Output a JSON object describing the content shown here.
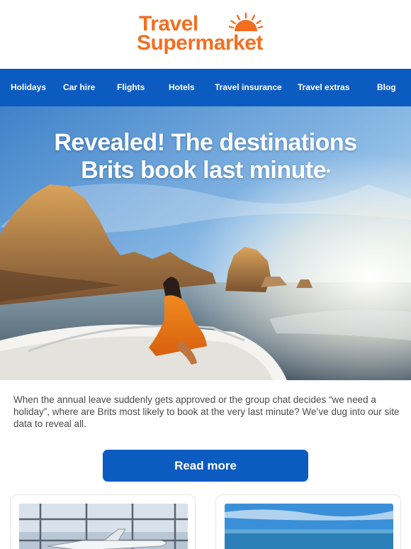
{
  "brand": {
    "line1": "Travel",
    "line2": "Supermarket",
    "color": "#f26f21",
    "logo_icon": "sun-icon"
  },
  "nav": {
    "background": "#0c5bc0",
    "items": [
      {
        "label": "Holidays"
      },
      {
        "label": "Car hire"
      },
      {
        "label": "Flights"
      },
      {
        "label": "Hotels"
      },
      {
        "label": "Travel insurance"
      },
      {
        "label": "Travel extras"
      },
      {
        "label": "Blog"
      }
    ]
  },
  "hero": {
    "title_line1": "Revealed! The destinations",
    "title_line2": "Brits book last minute",
    "title_mark": "*"
  },
  "intro": {
    "text": "When the annual leave suddenly gets approved or the group chat decides “we need a holiday”, where are Brits most likely to book at the very last minute? We’ve dug into our site data to reveal all."
  },
  "cta": {
    "label": "Read more",
    "color": "#0c5bc0"
  }
}
